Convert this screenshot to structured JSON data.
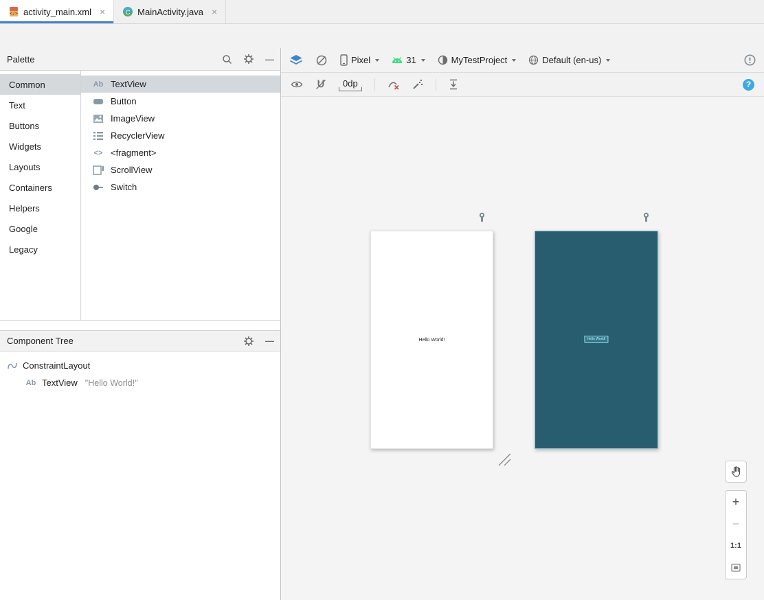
{
  "icons": {
    "close": "×",
    "minimize": "—",
    "plus": "+",
    "minus": "−",
    "textview_glyph": "Ab",
    "fragment_glyph": "<>"
  },
  "editor_tabs": [
    {
      "label": "activity_main.xml"
    },
    {
      "label": "MainActivity.java"
    }
  ],
  "palette": {
    "title": "Palette",
    "categories": [
      {
        "label": "Common"
      },
      {
        "label": "Text"
      },
      {
        "label": "Buttons"
      },
      {
        "label": "Widgets"
      },
      {
        "label": "Layouts"
      },
      {
        "label": "Containers"
      },
      {
        "label": "Helpers"
      },
      {
        "label": "Google"
      },
      {
        "label": "Legacy"
      }
    ],
    "components": [
      {
        "label": "TextView"
      },
      {
        "label": "Button"
      },
      {
        "label": "ImageView"
      },
      {
        "label": "RecyclerView"
      },
      {
        "label": "<fragment>"
      },
      {
        "label": "ScrollView"
      },
      {
        "label": "Switch"
      }
    ]
  },
  "component_tree": {
    "title": "Component Tree",
    "items": [
      {
        "label": "ConstraintLayout",
        "value": ""
      },
      {
        "label": "TextView",
        "value": "\"Hello World!\""
      }
    ]
  },
  "design_toolbar": {
    "device": "Pixel",
    "api_level": "31",
    "theme": "MyTestProject",
    "locale": "Default (en-us)"
  },
  "constraint_toolbar": {
    "default_margin": "0dp"
  },
  "canvas": {
    "design_preview_text": "Hello World!",
    "blueprint_selected_text": "Hello World!"
  },
  "zoom_controls": {
    "ratio_label": "1:1"
  },
  "colors": {
    "accent_blue": "#4083C9",
    "blueprint_teal": "#275D6F",
    "android_green": "#3DDC84",
    "help_blue": "#40A8E0",
    "selection_gray": "#D6D9DC"
  }
}
